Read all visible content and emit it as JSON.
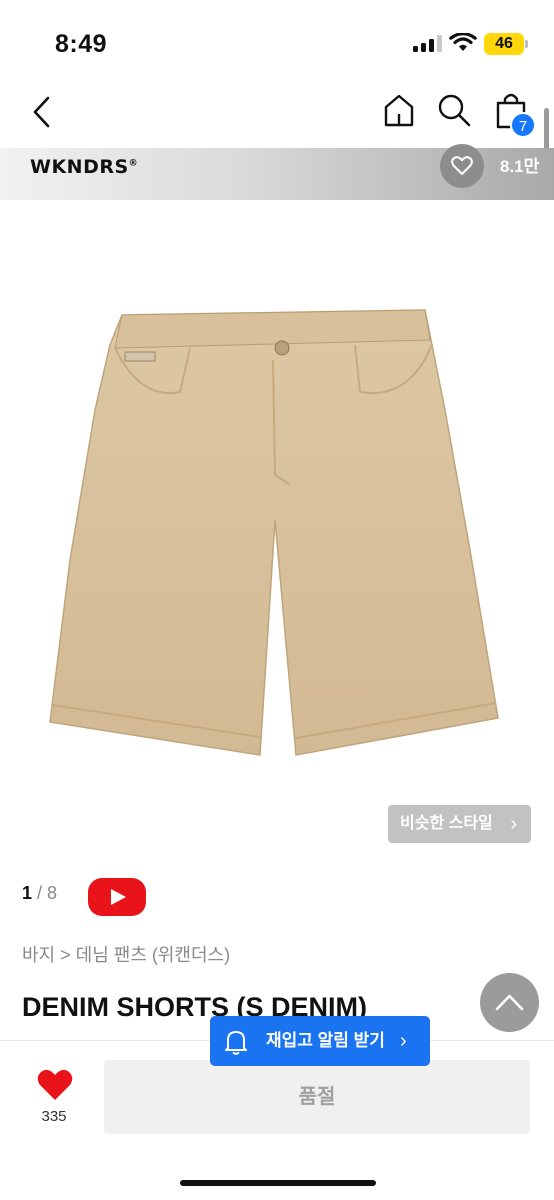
{
  "status_bar": {
    "time": "8:49",
    "battery": "46"
  },
  "nav": {
    "cart_count": "7"
  },
  "brand": {
    "name": "WKNDRS",
    "mark": "®",
    "likes": "8.1만"
  },
  "gallery": {
    "current": "1",
    "separator": " / ",
    "total": "8",
    "similar_label": "비슷한 스타일",
    "chevron": "›"
  },
  "product": {
    "breadcrumb": "바지 > 데님 팬츠 (위캔더스)",
    "title": "DENIM SHORTS (S DENIM)"
  },
  "actions": {
    "restock_label": "재입고 알림 받기",
    "restock_chevron": "›",
    "like_count": "335",
    "soldout_label": "품절"
  },
  "colors": {
    "accent_blue": "#1a73f0",
    "heart_red": "#e8141a",
    "cart_badge": "#1677ff",
    "battery": "#ffd60a"
  },
  "icons": [
    "back-icon",
    "home-icon",
    "search-icon",
    "cart-icon",
    "heart-icon",
    "youtube-icon",
    "bell-icon",
    "arrow-up-icon"
  ]
}
